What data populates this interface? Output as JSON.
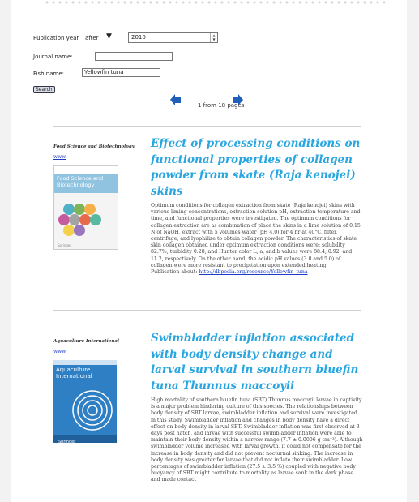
{
  "form": {
    "pubyear_label": "Publication year",
    "pubyear_mode": "after",
    "pubyear_value": "2010",
    "journal_label": "Journal name:",
    "journal_value": "",
    "fish_label": "Fish name:",
    "fish_value": "Yellowfin tuna",
    "search_label": "Search"
  },
  "pager": {
    "text": "1 from 18 pages"
  },
  "colors": {
    "title": "#29a6e0",
    "link": "#1a3cc8",
    "pager_arrow": "#1f5fb8"
  },
  "results": [
    {
      "journal": "Food Science and Biotechnology",
      "www": "www",
      "cover_title": "Food Science and Biotechnology",
      "title": "Effect of processing conditions on functional properties of collagen powder from skate (Raja kenojei) skins",
      "abstract": "Optimum conditions for collagen extraction from skate (Raja kenojei) skins with various liming concentrations, extraction solution pH, extraction temperature and time, and functional properties were investigated. The optimum conditions for collagen extraction are as combination of place the skins in a lime solution of 0.15 N of NaOH, extract with 5 volumes water (pH 4.0) for 4 hr at 40°C, filter, centrifuge, and lyophilize to obtain collagen powder. The characteristics of skate skin collagen obtained under optimum extraction conditions were: solubility 82.7%, turbidity 0.28, and Hunter color L, a, and b values were 88.4, 0.92, and 11.2, respectively. On the other hand, the acidic pH values (3.0 and 5.0) of collagen were more resistant to precipitation upon extended heating.",
      "about_label": "Publication about:",
      "about_link": "http://dbpedia.org/resource/Yellowfin_tuna"
    },
    {
      "journal": "Aquaculture International",
      "www": "www",
      "cover_title": "Aquaculture International",
      "title": "Swimbladder inflation associated with body density change and larval survival in southern bluefin tuna Thunnus maccoyii",
      "abstract": "High mortality of southern bluefin tuna (SBT) Thunnus maccoyii larvae in captivity is a major problem hindering culture of this species. The relationships between body density of SBT larvae, swimbladder inflation and survival were investigated in this study. Swimbladder inflation and changes in body density have a direct effect on body density in larval SBT. Swimbladder inflation was first observed at 3 days post hatch, and larvae with successful swimbladder inflation were able to maintain their body density within a narrow range (7.7 ± 0.0006 g cm⁻³). Although swimbladder volume increased with larval growth, it could not compensate for the increase in body density and did not prevent nocturnal sinking. The increase in body density was greater for larvae that did not inflate their swimbladder. Low percentages of swimbladder inflation (27.5 ± 3.5 %) coupled with negative body buoyancy of SBT might contribute to mortality as larvae sank in the dark phase and made contact"
    }
  ]
}
